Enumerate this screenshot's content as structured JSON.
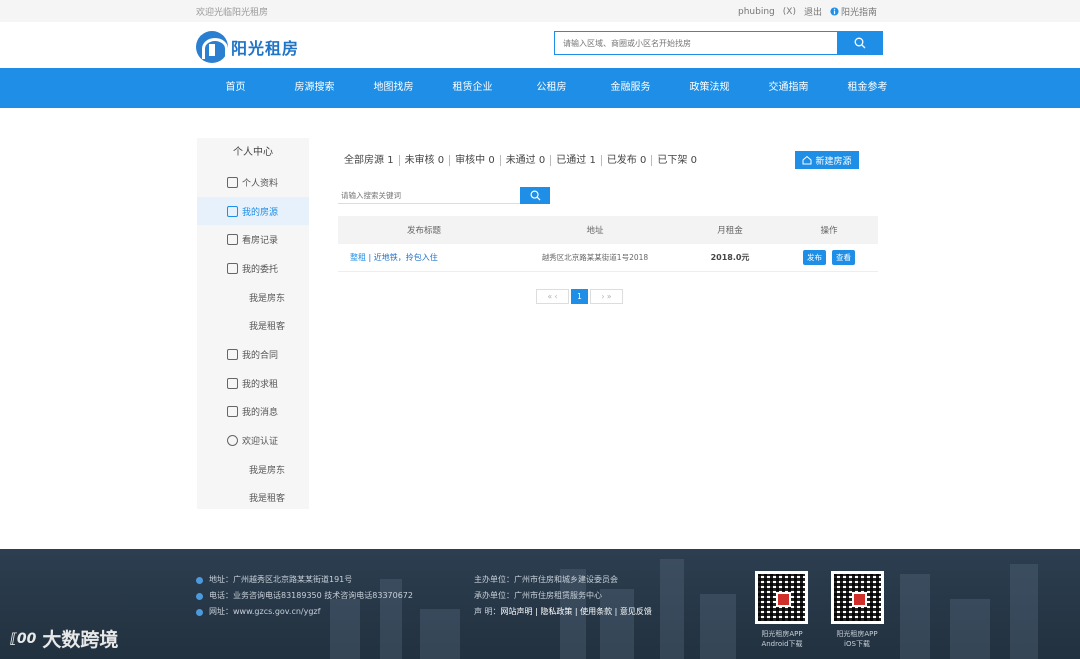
{
  "topbar": {
    "welcome": "欢迎光临阳光租房",
    "username": "phubing",
    "bracket": "(X)",
    "logout": "退出",
    "guide": "阳光指南"
  },
  "header": {
    "logo_text": "阳光租房",
    "search_placeholder": "请输入区域、商圈或小区名开始找房"
  },
  "nav": {
    "items": [
      "首页",
      "房源搜索",
      "地图找房",
      "租赁企业",
      "公租房",
      "金融服务",
      "政策法规",
      "交通指南",
      "租金参考"
    ]
  },
  "sidebar": {
    "title": "个人中心",
    "items": [
      {
        "label": "个人资料",
        "icon": "edit-icon"
      },
      {
        "label": "我的房源",
        "icon": "home-icon"
      },
      {
        "label": "看房记录",
        "icon": "calendar-icon"
      },
      {
        "label": "我的委托",
        "icon": "list-icon"
      },
      {
        "label": "我是房东",
        "icon": ""
      },
      {
        "label": "我是租客",
        "icon": ""
      },
      {
        "label": "我的合同",
        "icon": "document-icon"
      },
      {
        "label": "我的求租",
        "icon": "house-icon"
      },
      {
        "label": "我的消息",
        "icon": "message-icon"
      },
      {
        "label": "欢迎认证",
        "icon": "eye-icon"
      },
      {
        "label": "我是房东",
        "icon": ""
      },
      {
        "label": "我是租客",
        "icon": ""
      }
    ]
  },
  "filters": [
    {
      "label": "全部房源",
      "count": "1"
    },
    {
      "label": "未审核",
      "count": "0"
    },
    {
      "label": "审核中",
      "count": "0"
    },
    {
      "label": "未通过",
      "count": "0"
    },
    {
      "label": "已通过",
      "count": "1"
    },
    {
      "label": "已发布",
      "count": "0"
    },
    {
      "label": "已下架",
      "count": "0"
    }
  ],
  "new_button": "新建房源",
  "list_search_placeholder": "请输入搜索关键词",
  "table": {
    "headers": [
      "发布标题",
      "地址",
      "月租金",
      "操作"
    ],
    "rows": [
      {
        "type": "整租",
        "title": "| 近地铁，拎包入住",
        "address": "越秀区北京路某某街道1号2018",
        "rent": "2018.0元",
        "actions": [
          "发布",
          "查看"
        ]
      }
    ]
  },
  "pager": {
    "prev": "« ‹",
    "current": "1",
    "next": "› »"
  },
  "footer": {
    "address": "地址：广州越秀区北京路某某街道191号",
    "phone": "电话：业务咨询电话83189350  技术咨询电话83370672",
    "website": "网址：www.gzcs.gov.cn/ygzf",
    "sponsor": "主办单位：广州市住房和城乡建设委员会",
    "maker": "承办单位：广州市住房租赁服务中心",
    "links_label": "声    明：",
    "links": "网站声明 | 隐私政策 | 使用条款 | 意见反馈",
    "qr1_caption": [
      "阳光租房APP",
      "Android下载"
    ],
    "qr2_caption": [
      "阳光租房APP",
      "iOS下载"
    ]
  },
  "watermark": {
    "mark": "⟦00",
    "text": "大数跨境"
  }
}
